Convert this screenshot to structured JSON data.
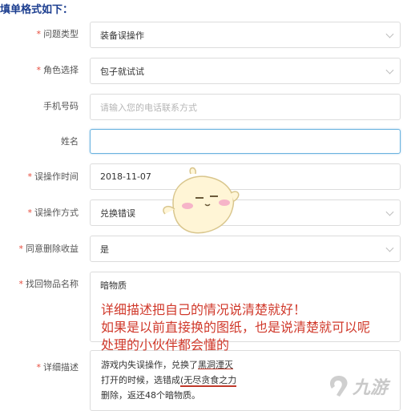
{
  "heading": "填单格式如下：",
  "form": {
    "issue_type": {
      "label": "问题类型",
      "value": "装备误操作"
    },
    "role": {
      "label": "角色选择",
      "value": "包子就试试"
    },
    "phone": {
      "label": "手机号码",
      "placeholder": "请输入您的电话联系方式"
    },
    "name": {
      "label": "姓名",
      "value": ""
    },
    "time": {
      "label": "误操作时间",
      "value": "2018-11-07"
    },
    "method": {
      "label": "误操作方式",
      "value": "兑换错误"
    },
    "agree": {
      "label": "同意删除收益",
      "value": "是"
    },
    "item": {
      "label": "找回物品名称",
      "value": "暗物质"
    },
    "detail": {
      "label": "详细描述",
      "line1_a": "游戏内失误操作，兑换了",
      "line1_b": "黑洞湮灭",
      "line2_a": "打开的时候，选错成",
      "line2_b": "(无尽贪食之力",
      "line3": "删除，返还48个暗物质。"
    }
  },
  "annotation": {
    "line1": "详细描述把自己的情况说清楚就好！",
    "line2": "如果是以前直接换的图纸，也是说清楚就可以呢",
    "line3": "处理的小伙伴都会懂的"
  },
  "logo": {
    "text": "九游"
  },
  "colors": {
    "required": "#e64a3b",
    "annotation": "#d0392b",
    "heading": "#1b3d8f",
    "focus_border": "#6ab3df"
  }
}
